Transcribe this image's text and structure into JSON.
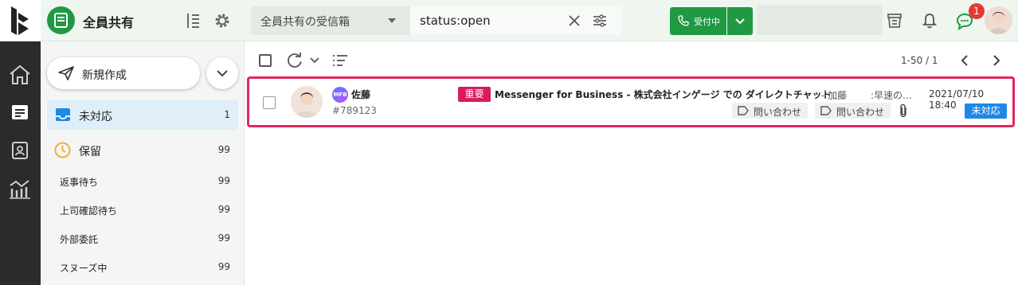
{
  "header": {
    "workspace_title": "全員共有",
    "inbox_select_label": "全員共有の受信箱",
    "search_value": "status:open",
    "reception_label": "受付中",
    "notification_badge": "1"
  },
  "sidebar": {
    "new_button_label": "新規作成",
    "nav": [
      {
        "label": "未対応",
        "count": "1"
      },
      {
        "label": "保留",
        "count": "99"
      }
    ],
    "sub": [
      {
        "label": "返事待ち",
        "count": "99"
      },
      {
        "label": "上司確認待ち",
        "count": "99"
      },
      {
        "label": "外部委託",
        "count": "99"
      },
      {
        "label": "スヌーズ中",
        "count": "99"
      }
    ]
  },
  "main": {
    "pagination": "1-50 / 1",
    "messages": [
      {
        "sender": "佐藤",
        "channel_badge": "MFB",
        "ticket_id": "#789123",
        "priority_tag": "重要",
        "subject": "Messenger for Business - 株式会社インゲージ での ダイレクトチャット",
        "from": "- 加藤",
        "preview": ":早速の…",
        "date": "2021/07/10 18:40",
        "tags": [
          "問い合わせ",
          "問い合わせ"
        ],
        "status": "未対応"
      }
    ]
  },
  "colors": {
    "brand_green": "#1f9a43",
    "highlight_pink": "#e0285a",
    "important_tag": "#d81b60",
    "status_blue": "#1e88e5",
    "rail_dark": "#2b2b2b"
  }
}
